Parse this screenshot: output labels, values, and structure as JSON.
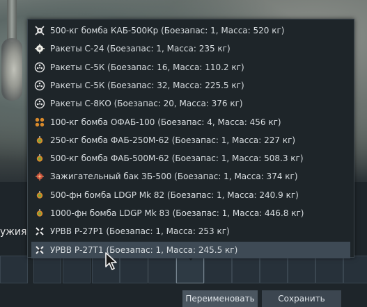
{
  "background": {
    "side_label": "ужия",
    "close_glyph": "✕"
  },
  "dropdown": {
    "selected_index": 12,
    "items": [
      {
        "icon": "guided-bomb-icon",
        "label": "500-кг бомба КАБ-500Кр (Боезапас: 1, Масса: 520 кг)"
      },
      {
        "icon": "rocket-icon",
        "label": "Ракеты С-24 (Боезапас: 1, Масса: 235 кг)"
      },
      {
        "icon": "rocket-pod-icon",
        "label": "Ракеты С-5К (Боезапас: 16, Масса: 110.2 кг)"
      },
      {
        "icon": "rocket-pod-icon",
        "label": "Ракеты С-5К (Боезапас: 32, Масса: 225.5 кг)"
      },
      {
        "icon": "rocket-pod-icon",
        "label": "Ракеты С-8КО (Боезапас: 20, Масса: 376 кг)"
      },
      {
        "icon": "bomb-cluster-icon",
        "label": "100-кг бомба ОФАБ-100 (Боезапас: 4, Масса: 456 кг)"
      },
      {
        "icon": "bomb-icon",
        "label": "250-кг бомба ФАБ-250М-62 (Боезапас: 1, Масса: 227 кг)"
      },
      {
        "icon": "bomb-icon",
        "label": "500-кг бомба ФАБ-500М-62 (Боезапас: 1, Масса: 508.3 кг)"
      },
      {
        "icon": "incendiary-tank-icon",
        "label": "Зажигательный бак ЗБ-500 (Боезапас: 1, Масса: 374 кг)"
      },
      {
        "icon": "bomb-icon",
        "label": "500-фн бомба LDGP Mk 82 (Боезапас: 1, Масса: 240.9 кг)"
      },
      {
        "icon": "bomb-icon",
        "label": "1000-фн бомба LDGP Mk 83 (Боезапас: 1, Масса: 446.8 кг)"
      },
      {
        "icon": "missile-icon",
        "label": "УРВВ Р-27Р1 (Боезапас: 1, Масса: 253 кг)"
      },
      {
        "icon": "missile-icon",
        "label": "УРВВ Р-27Т1 (Боезапас: 1, Масса: 245.5 кг)"
      }
    ]
  },
  "slots": {
    "active_index": 6
  },
  "buttons": {
    "rename": "Переименовать",
    "save": "Сохранить"
  },
  "colors": {
    "menu_bg": "#1e2529",
    "selected_bg": "#3e4a55",
    "text": "#d8dde0",
    "bomb_green": "#7aa33a",
    "bomb_orange": "#d98a2b"
  }
}
